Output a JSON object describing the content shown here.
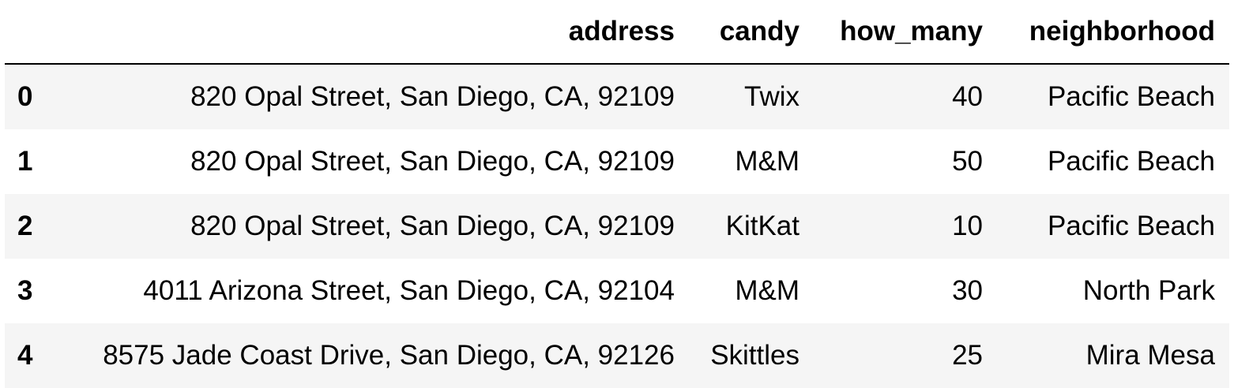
{
  "table": {
    "columns": [
      "",
      "address",
      "candy",
      "how_many",
      "neighborhood"
    ],
    "rows": [
      {
        "index": "0",
        "address": "820 Opal Street, San Diego, CA, 92109",
        "candy": "Twix",
        "how_many": "40",
        "neighborhood": "Pacific Beach"
      },
      {
        "index": "1",
        "address": "820 Opal Street, San Diego, CA, 92109",
        "candy": "M&M",
        "how_many": "50",
        "neighborhood": "Pacific Beach"
      },
      {
        "index": "2",
        "address": "820 Opal Street, San Diego, CA, 92109",
        "candy": "KitKat",
        "how_many": "10",
        "neighborhood": "Pacific Beach"
      },
      {
        "index": "3",
        "address": "4011 Arizona Street, San Diego, CA, 92104",
        "candy": "M&M",
        "how_many": "30",
        "neighborhood": "North Park"
      },
      {
        "index": "4",
        "address": "8575 Jade Coast Drive, San Diego, CA, 92126",
        "candy": "Skittles",
        "how_many": "25",
        "neighborhood": "Mira Mesa"
      }
    ]
  }
}
